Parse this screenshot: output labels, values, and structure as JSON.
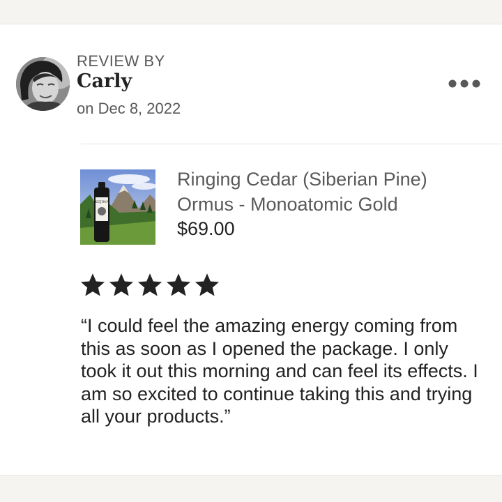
{
  "review": {
    "header_label": "REVIEW BY",
    "reviewer_name": "Carly",
    "date": "on Dec 8, 2022",
    "rating": 5,
    "text": "“I could feel the amazing energy coming from this as soon as I opened the package. I only took it out this morning and can feel its effects. I am so excited to continue taking this and trying all your products.”"
  },
  "product": {
    "title": "Ringing Cedar (Siberian Pine) Ormus - Monoatomic Gold",
    "price": "$69.00",
    "bottle_label": "KEJIWA"
  },
  "icons": {
    "more": "more-horizontal-icon",
    "star": "star-icon"
  },
  "colors": {
    "text_primary": "#222222",
    "text_secondary": "#595959",
    "background": "#f5f4f0"
  }
}
